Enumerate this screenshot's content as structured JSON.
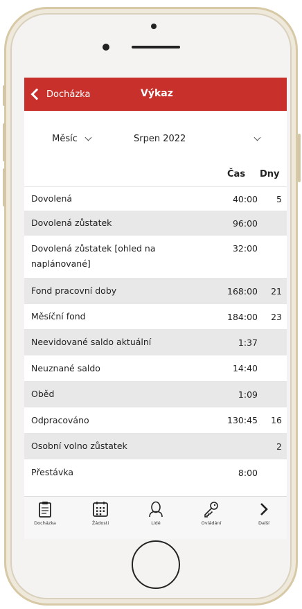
{
  "header": {
    "back_label": "Docházka",
    "title": "Výkaz"
  },
  "filters": {
    "period_type": "Měsíc",
    "period_value": "Srpen 2022"
  },
  "columns": {
    "cas": "Čas",
    "dny": "Dny"
  },
  "rows": [
    {
      "label": "Dovolená",
      "cas": "40:00",
      "dny": "5"
    },
    {
      "label": "Dovolená zůstatek",
      "cas": "96:00",
      "dny": ""
    },
    {
      "label": "Dovolená zůstatek [ohled na naplánované]",
      "cas": "32:00",
      "dny": ""
    },
    {
      "label": "Fond pracovní doby",
      "cas": "168:00",
      "dny": "21"
    },
    {
      "label": "Měsíční fond",
      "cas": "184:00",
      "dny": "23"
    },
    {
      "label": "Neevidované saldo aktuální",
      "cas": "1:37",
      "dny": ""
    },
    {
      "label": "Neuznané saldo",
      "cas": "14:40",
      "dny": ""
    },
    {
      "label": "Oběd",
      "cas": "1:09",
      "dny": ""
    },
    {
      "label": "Odpracováno",
      "cas": "130:45",
      "dny": "16"
    },
    {
      "label": "Osobní volno zůstatek",
      "cas": "",
      "dny": "2"
    },
    {
      "label": "Přestávka",
      "cas": "8:00",
      "dny": ""
    }
  ],
  "tabbar": {
    "items": [
      {
        "label": "Docházka",
        "icon": "clipboard-icon"
      },
      {
        "label": "Žádosti",
        "icon": "calendar-icon"
      },
      {
        "label": "Lidé",
        "icon": "person-icon"
      },
      {
        "label": "Ovládání",
        "icon": "key-icon"
      },
      {
        "label": "Další",
        "icon": "chevron-right-icon"
      }
    ]
  },
  "colors": {
    "accent": "#c8302b",
    "row_shade": "#e8e8e8"
  }
}
